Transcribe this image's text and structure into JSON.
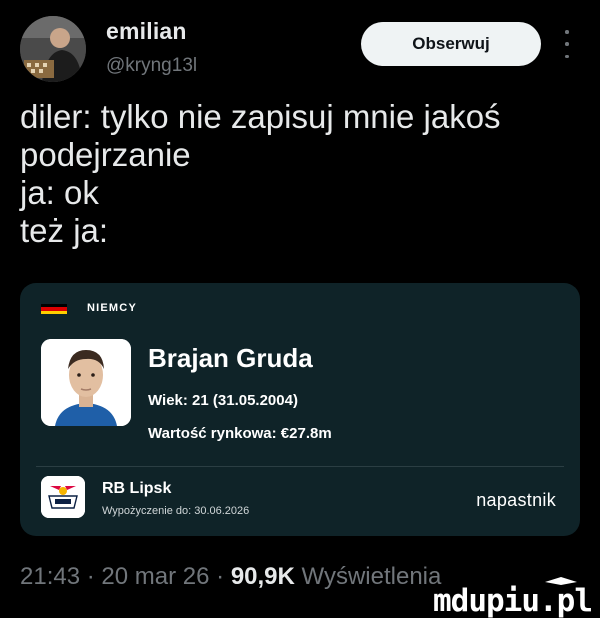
{
  "tweet": {
    "display_name": "emilian",
    "handle": "@kryng13l",
    "follow_label": "Obserwuj",
    "text_lines": [
      "diler: tylko nie zapisuj mnie jakoś",
      "podejrzanie",
      "ja: ok",
      "też ja:"
    ],
    "time": "21:43",
    "date": "20 mar 26",
    "views_count": "90,9K",
    "views_label": "Wyświetlenia",
    "separator": "·"
  },
  "card": {
    "country": "NIEMCY",
    "flag_colors": [
      "#000000",
      "#dd0000",
      "#ffce00"
    ],
    "player_name": "Brajan Gruda",
    "age_line": "Wiek: 21 (31.05.2004)",
    "value_line": "Wartość rynkowa: €27.8m",
    "club_name": "RB Lipsk",
    "loan_line": "Wypożyczenie do: 30.06.2026",
    "position": "napastnik",
    "background_color": "#0f2328"
  },
  "watermark": "mdupiu.pl",
  "icons": {
    "more": "more-vertical-icon"
  }
}
